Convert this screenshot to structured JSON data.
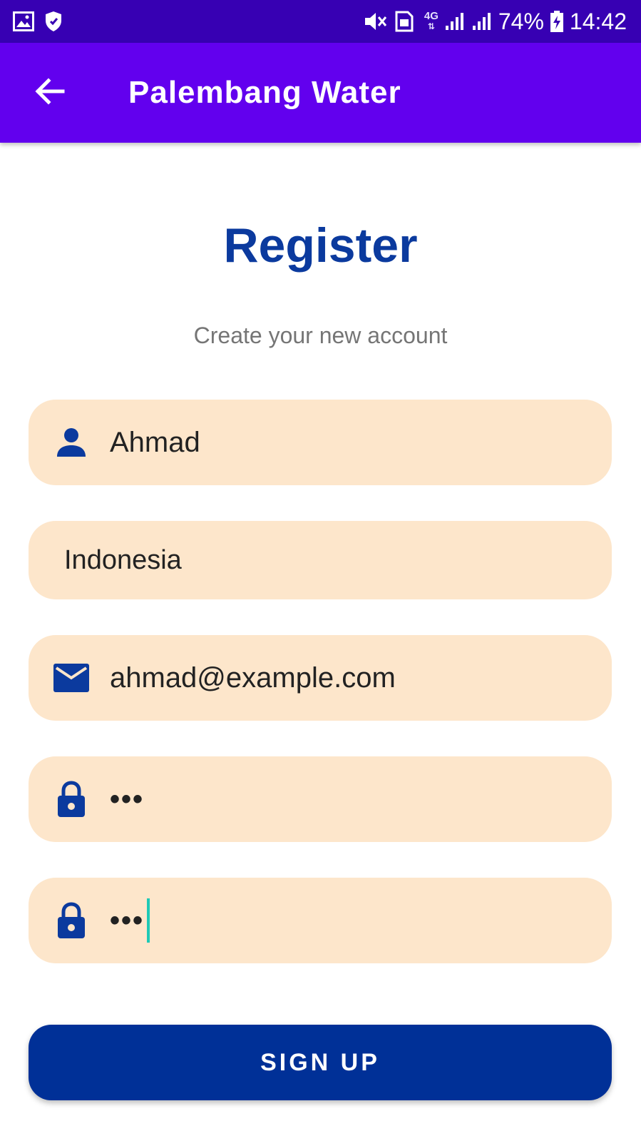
{
  "status_bar": {
    "battery": "74%",
    "time": "14:42",
    "network": "4G",
    "icons": [
      "image-icon",
      "shield-icon",
      "vibrate-mute-icon",
      "sim-icon",
      "signal-icon",
      "signal-icon",
      "battery-charging-icon"
    ]
  },
  "app_bar": {
    "title": "Palembang Water",
    "back_icon": "arrow-left-icon"
  },
  "header": {
    "title": "Register",
    "subtitle": "Create your new account"
  },
  "form": {
    "name": {
      "icon": "person-icon",
      "value": "Ahmad"
    },
    "country": {
      "value": "Indonesia"
    },
    "email": {
      "icon": "email-icon",
      "value": "ahmad@example.com"
    },
    "password": {
      "icon": "lock-icon",
      "value": "•••"
    },
    "confirm_password": {
      "icon": "lock-icon",
      "value": "•••"
    }
  },
  "signup_button": {
    "label": "SIGN UP"
  },
  "colors": {
    "status_bar": "#3700b3",
    "app_bar": "#6200ee",
    "primary": "#0b3a9e",
    "field_bg": "#fde6cb",
    "button": "#003097",
    "cursor": "#1ec9b6"
  }
}
